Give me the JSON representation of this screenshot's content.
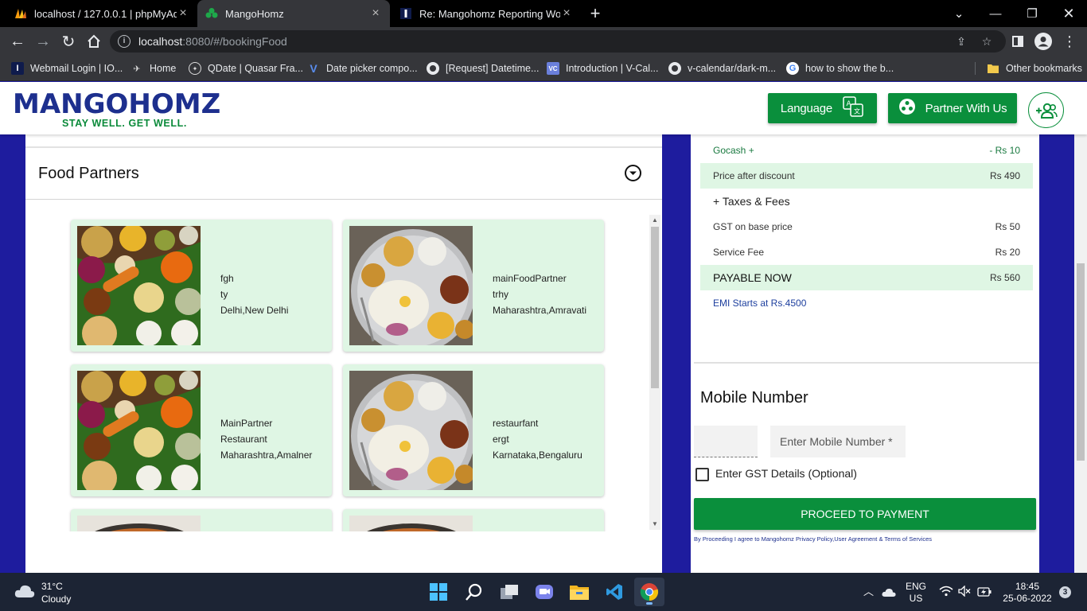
{
  "browser": {
    "tabs": [
      {
        "title": "localhost / 127.0.0.1 | phpMyAdmin",
        "icon": "phpmyadmin-icon"
      },
      {
        "title": "MangoHomz",
        "icon": "mangohomz-icon"
      },
      {
        "title": "Re: Mangohomz Reporting Work",
        "icon": "mail-icon"
      }
    ],
    "url_host": "localhost",
    "url_path": ":8080/#/bookingFood",
    "bookmarks": [
      "Webmail Login | IO...",
      "Home",
      "QDate | Quasar Fra...",
      "Date picker compo...",
      "[Request] Datetime...",
      "Introduction | V-Cal...",
      "v-calendar/dark-m...",
      "how to show the b..."
    ],
    "other_bookmarks": "Other bookmarks"
  },
  "header": {
    "logo_text": "MANGOHOMZ",
    "tagline": "STAY WELL. GET WELL.",
    "language_label": "Language",
    "partner_label": "Partner With Us"
  },
  "food_partners": {
    "title": "Food Partners",
    "partners": [
      {
        "name": "fgh",
        "type": "ty",
        "location": "Delhi,New Delhi"
      },
      {
        "name": "mainFoodPartner",
        "type": "trhy",
        "location": "Maharashtra,Amravati"
      },
      {
        "name": "MainPartner",
        "type": "Restaurant",
        "location": "Maharashtra,Amalner"
      },
      {
        "name": "restaurfant",
        "type": "ergt",
        "location": "Karnataka,Bengaluru"
      }
    ]
  },
  "summary": {
    "gocash_label": "Gocash +",
    "gocash_value": "- Rs 10",
    "price_after_discount_label": "Price after discount",
    "price_after_discount_value": "Rs 490",
    "taxes_label": "+ Taxes & Fees",
    "gst_label": "GST on base price",
    "gst_value": "Rs 50",
    "service_label": "Service Fee",
    "service_value": "Rs 20",
    "payable_label": "PAYABLE NOW",
    "payable_value": "Rs 560",
    "emi_text": "EMI Starts at Rs.4500"
  },
  "mobile": {
    "title": "Mobile Number",
    "placeholder": "Enter Mobile Number *",
    "gst_option": "Enter GST Details (Optional)",
    "proceed_label": "PROCEED TO PAYMENT",
    "terms": "By Proceeding I agree to Mangohomz Privacy Policy,User Agreement & Terms of Services"
  },
  "taskbar": {
    "temperature": "31°C",
    "weather": "Cloudy",
    "lang_top": "ENG",
    "lang_bottom": "US",
    "time": "18:45",
    "date": "25-06-2022",
    "notifications": "3"
  },
  "colors": {
    "brand_green": "#0a8f3c",
    "brand_blue": "#1d2f8e",
    "card_bg": "#dff6e4",
    "page_bg": "#1e1c9e"
  }
}
